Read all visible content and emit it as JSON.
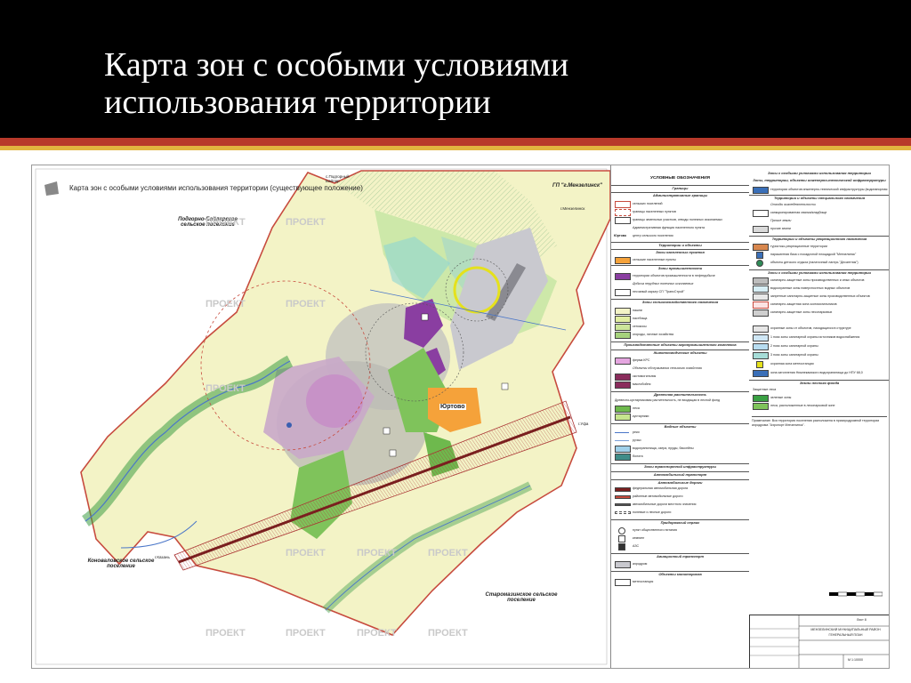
{
  "slide": {
    "title_line1": "Карта зон с особыми условиями",
    "title_line2": "использования территории",
    "colors": {
      "header_bg": "#000000",
      "accent_red": "#b8392a",
      "accent_gold": "#e2b43f"
    }
  },
  "map": {
    "title": "Карта зон с особыми условиями использования территории (существующее положение)",
    "stamp": "ПРОЕКТ",
    "labels": {
      "neighbor_nw": "Подгорно-Байларское сельское поселение",
      "neighbor_sw": "Коноваловское сельское поселение",
      "neighbor_se": "Старомазинское сельское поселение",
      "town_ne": "ГП \"г.Мензелинск\"",
      "village": "Юртово",
      "to_podgorny": "с.Подгорный Байлар",
      "to_menzelinsk": "г.Мензелинск",
      "to_ufa": "г.Уфа",
      "to_kazan": "г.Казань"
    }
  },
  "legend": {
    "title": "УСЛОВНЫЕ ОБОЗНАЧЕНИЯ",
    "left": {
      "boundaries_header": "Границы",
      "admin_header": "Административные границы",
      "rows_admin": [
        "сельских поселений",
        "границы населенных пунктов",
        "границы земельных участков, отводы полезных ископаемых",
        "Административная функция населенного пункта"
      ],
      "center_label": "центр сельского поселения",
      "center_code": "Юртово",
      "territories_header": "Территории и объекты",
      "settlements_header": "Зоны населенных пунктов",
      "settlement_row": "сельские населенные пункты",
      "industrial_header": "Зоны промышленности",
      "industrial_rows": [
        "территории объектов промышленности в нефтедобыче",
        "Добыча нерудных полезных ископаемых",
        "песчаный карьер СП \"ТрансСтрой\""
      ],
      "agri_header": "Зоны сельскохозяйственного назначения",
      "agri_rows": [
        "пашни",
        "пастбища",
        "сенокосы",
        "огороды, личные хозяйства"
      ],
      "agri_objects_header": "Производственные объекты агропромышленного комплекса",
      "livestock_header": "Животноводческие объекты",
      "livestock_rows": [
        "ферма КРС",
        "Объекты обслуживания сельского хозяйства",
        "скотомогильник",
        "маслобойня"
      ],
      "vegetation_header": "Древесная растительность",
      "vegetation_intro": "Древесно-кустарниковая растительность, не входящая в лесной фонд",
      "vegetation_rows": [
        "леса",
        "кустарники"
      ],
      "water_header": "Водные объекты",
      "water_rows": [
        "реки",
        "ручьи",
        "водохранилища, озера, пруды, бассейны",
        "болота"
      ],
      "transport_header": "Зоны транспортной инфраструктуры",
      "auto_header": "Автомобильный транспорт",
      "road_header": "Автомобильные дороги",
      "road_rows": [
        "федеральная автомобильная дорога",
        "районные автомобильные дороги",
        "автомобильные дороги местного значения",
        "полевые и лесные дороги"
      ],
      "service_header": "Придорожный сервис",
      "service_rows": [
        "пункт общественного питания",
        "кемпинг",
        "АЗС"
      ],
      "air_header": "Авиационный транспорт",
      "air_rows": [
        "аэродром"
      ],
      "monitoring_header": "Объекты мониторинга",
      "monitoring_rows": [
        "метеостанция"
      ]
    },
    "right": {
      "zouit_header": "Зоны с особыми условиями использования территории",
      "engineering_header": "Зоны, территории, объекты инженерно-технической инфраструктуры",
      "engineering_rows": [
        "территории объектов инженерно-технической инфраструктуры (водонапорная башня)",
        "Территории и объекты специального назначения",
        "Отходы жизнедеятельности",
        "санкционированная свалка/кладбище",
        "Прочие земли",
        "прочие земли"
      ],
      "recreation_header": "Территории и объекты рекреационного назначения",
      "recreation_rows": [
        "туристско-рекреационные территории",
        "парашютная база с посадочной площадкой \"Мензелинск\"",
        "объекты детского отдыха (палаточный лагерь \"Десантник\")"
      ],
      "zones_header": "Зоны с особыми условиями использования территории",
      "zone_rows": [
        "санитарно-защитные зоны производственных и иных объектов",
        "водоохранные зоны поверхностных водных объектов",
        "запретные санитарно-защитные зоны производственных объектов",
        "санитарно-защитная зона скотомогильников",
        "санитарно-защитные зоны лесопарковых",
        "охранные зоны от объектов, находящихся в структуре",
        "1 пояс зоны санитарной охраны источников водоснабжения",
        "2 пояс зоны санитарной охраны",
        "3 пояс зоны санитарной охраны",
        "охранная зона метеостанции",
        "зона затопления Нижнекамского водохранилища до НПУ 68,0"
      ],
      "forest_header": "Земли лесного фонда",
      "forest_sub": "Защитные леса",
      "forest_rows": [
        "зеленые зоны",
        "леса, расположенные в лесопарковой зоне"
      ],
      "notes": "Примечание: Вся территория поселения расположена в приаэродромной территории аэродрома \"Аэропорт Мензелинск\"."
    },
    "titleblock": {
      "sheet_no": "Лист 8",
      "org_line": "МЕНЗЕЛИНСКИЙ МУНИЦИПАЛЬНЫЙ РАЙОН",
      "project_line": "ГЕНЕРАЛЬНЫЙ ПЛАН",
      "scale_label": "М 1:10000"
    }
  }
}
